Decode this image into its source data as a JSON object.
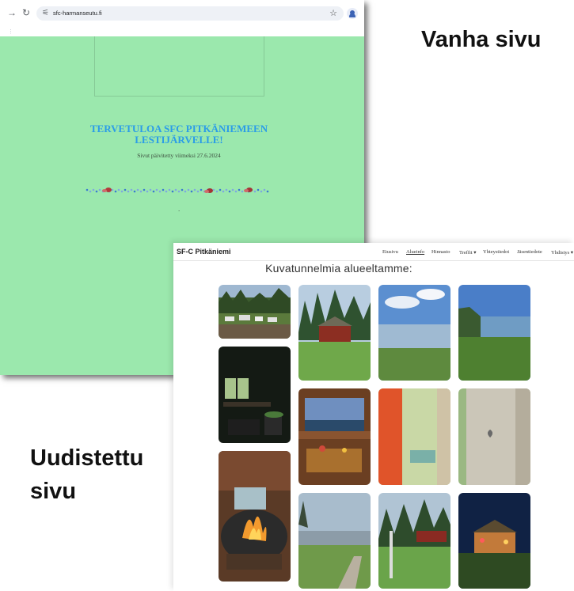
{
  "labels": {
    "old_page": "Vanha sivu",
    "new_page_line1": "Uudistettu",
    "new_page_line2": "sivu"
  },
  "old_site": {
    "url": "sfc-harmanseutu.fi",
    "heading_line1": "TERVETULOA SFC PITKÄNIEMEEN",
    "heading_line2": "LESTIJÄRVELLE!",
    "updated_text": "Sivut päivitetty viimeksi 27.6.2024",
    "dot": ".",
    "strip_mark": "⋮",
    "icons": [
      "back-arrow-icon",
      "reload-icon",
      "site-info-icon",
      "bookmark-star-icon",
      "profile-icon"
    ]
  },
  "new_site": {
    "brand": "SF-C Pitkäniemi",
    "nav": [
      "Etusivu",
      "Alueinfo",
      "Hinnasto",
      "Treffit ▾",
      "Yhteystiedot",
      "Jäsentiedote",
      "Yhdistys ▾"
    ],
    "active_nav": "Alueinfo",
    "gallery_heading": "Kuvatunnelmia alueeltamme:",
    "gallery": [
      {
        "id": "campsite-caravans",
        "kind": "photo"
      },
      {
        "id": "red-cabin-forest",
        "kind": "photo"
      },
      {
        "id": "lake-clouds",
        "kind": "photo"
      },
      {
        "id": "lake-shore-trees",
        "kind": "photo"
      },
      {
        "id": "sauna-interior-window",
        "kind": "photo"
      },
      {
        "id": "gazebo-table-lake",
        "kind": "photo"
      },
      {
        "id": "red-outhouse-door",
        "kind": "photo"
      },
      {
        "id": "grey-outhouse-heart",
        "kind": "photo"
      },
      {
        "id": "grill-hut-fire",
        "kind": "photo"
      },
      {
        "id": "lake-evening-shore",
        "kind": "photo"
      },
      {
        "id": "cabins-smoke-lawn",
        "kind": "photo"
      },
      {
        "id": "lit-gazebo-night",
        "kind": "photo"
      }
    ]
  }
}
